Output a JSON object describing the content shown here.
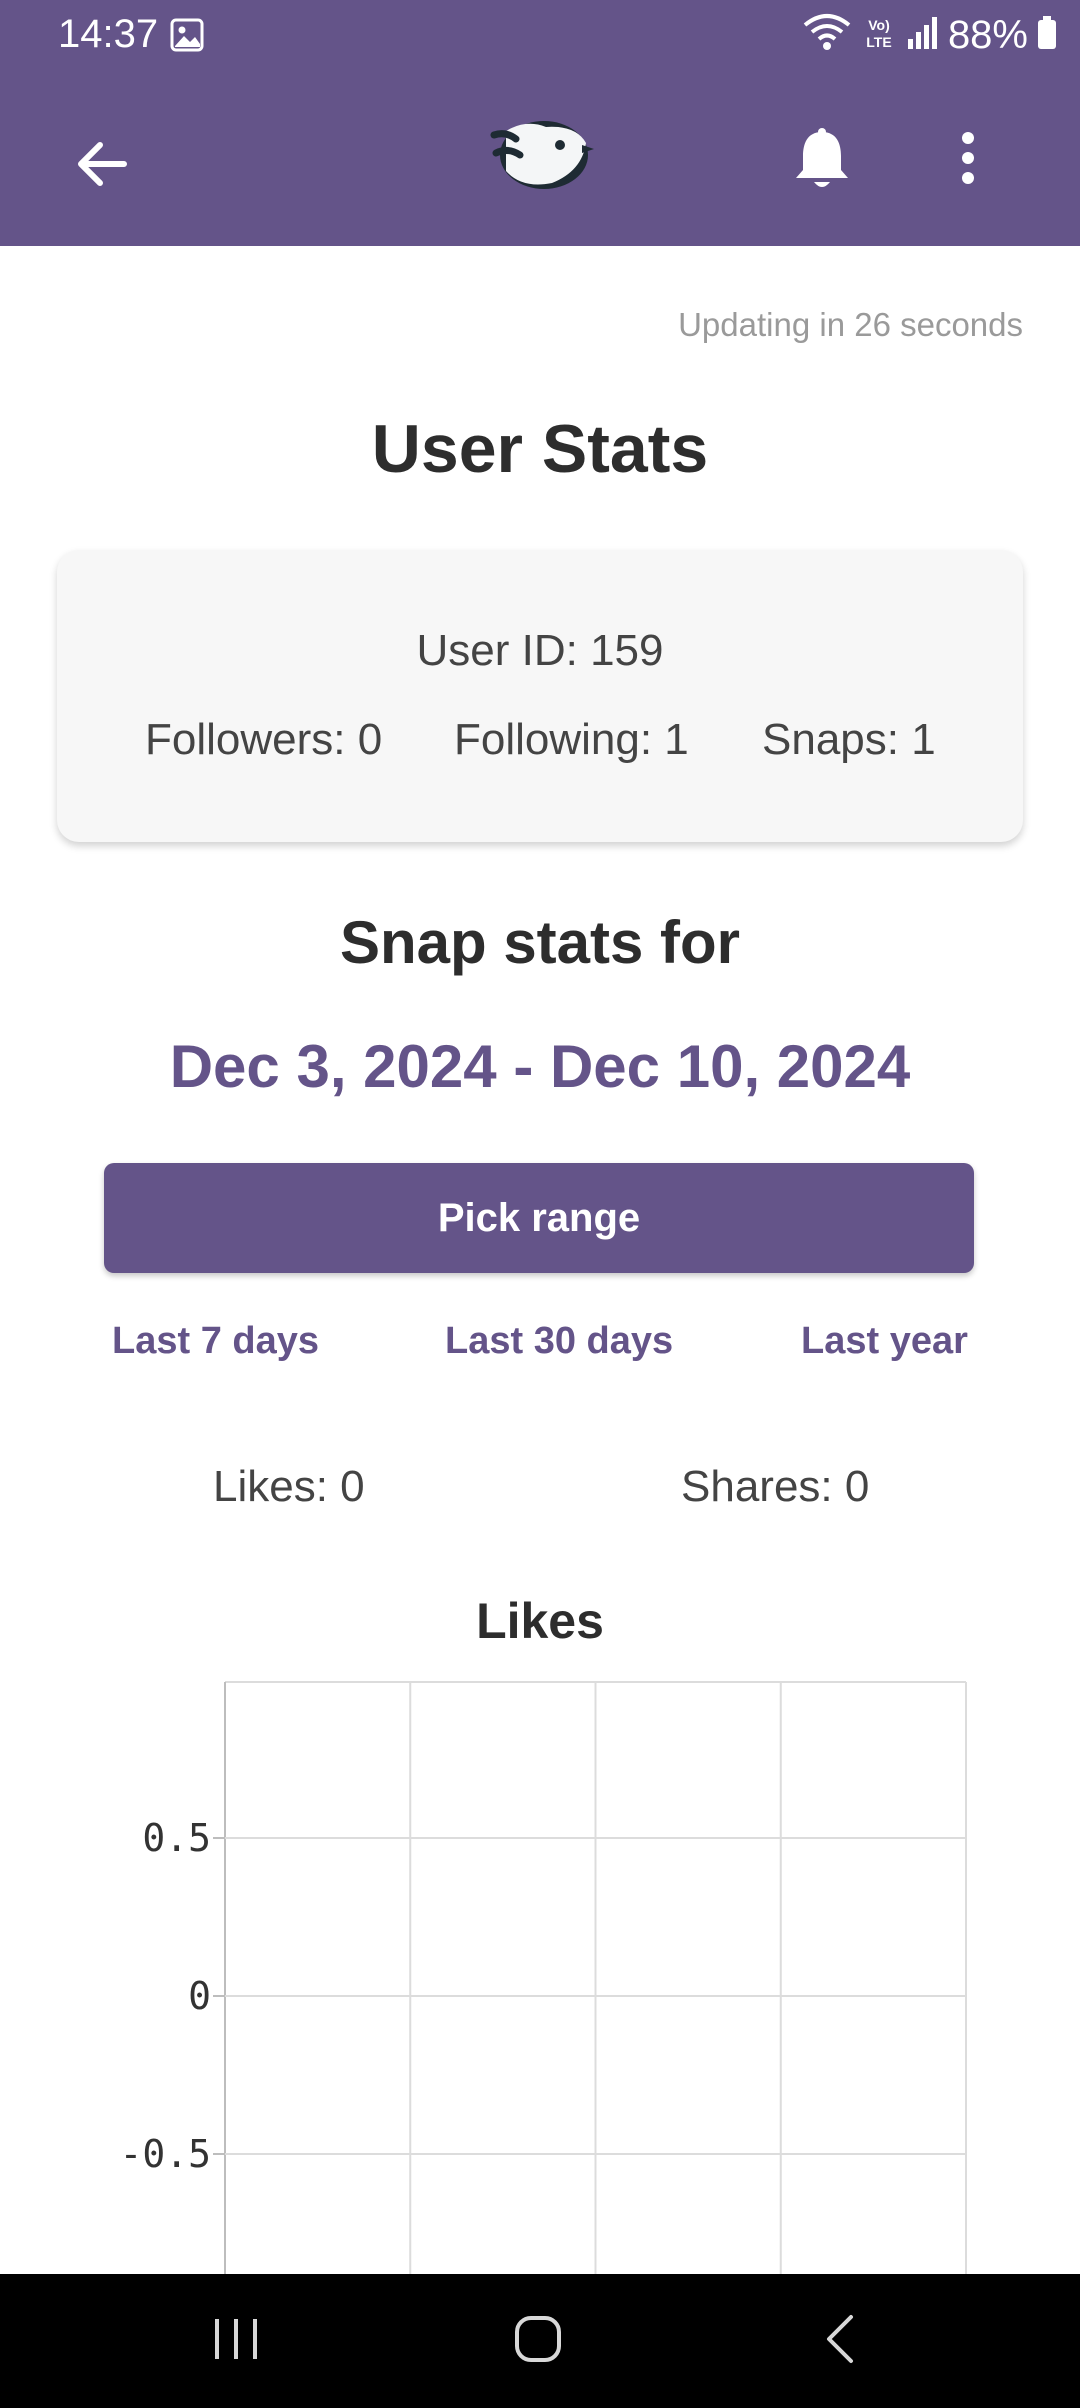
{
  "status_bar": {
    "time": "14:37",
    "battery": "88%",
    "network_label": "VoLTE"
  },
  "app_bar": {
    "background": "#645489",
    "icons": [
      "back-arrow-icon",
      "app-logo-bird",
      "bell-icon",
      "more-vertical-icon"
    ]
  },
  "updating_text": "Updating in 26 seconds",
  "page_title": "User Stats",
  "user_card": {
    "user_id": "User ID: 159",
    "followers": "Followers: 0",
    "following": "Following: 1",
    "snaps": "Snaps: 1"
  },
  "snap_stats": {
    "heading": "Snap stats for",
    "date_range": "Dec 3, 2024 - Dec 10, 2024",
    "pick_range_label": "Pick range",
    "quick_ranges": [
      "Last 7 days",
      "Last 30 days",
      "Last year"
    ],
    "likes": "Likes: 0",
    "shares": "Shares: 0"
  },
  "chart_data": {
    "type": "line",
    "title": "Likes",
    "series": [],
    "x": [],
    "ylim": [
      -1,
      1
    ],
    "yticks": [
      0.5,
      0,
      -0.5
    ],
    "ytick_labels": [
      "0.5",
      "0",
      "-0.5"
    ],
    "grid": true
  },
  "colors": {
    "accent": "#645489",
    "text_dark": "#2d2d2d",
    "text_muted": "#9a9a9a",
    "card_bg": "#f7f7f7"
  }
}
